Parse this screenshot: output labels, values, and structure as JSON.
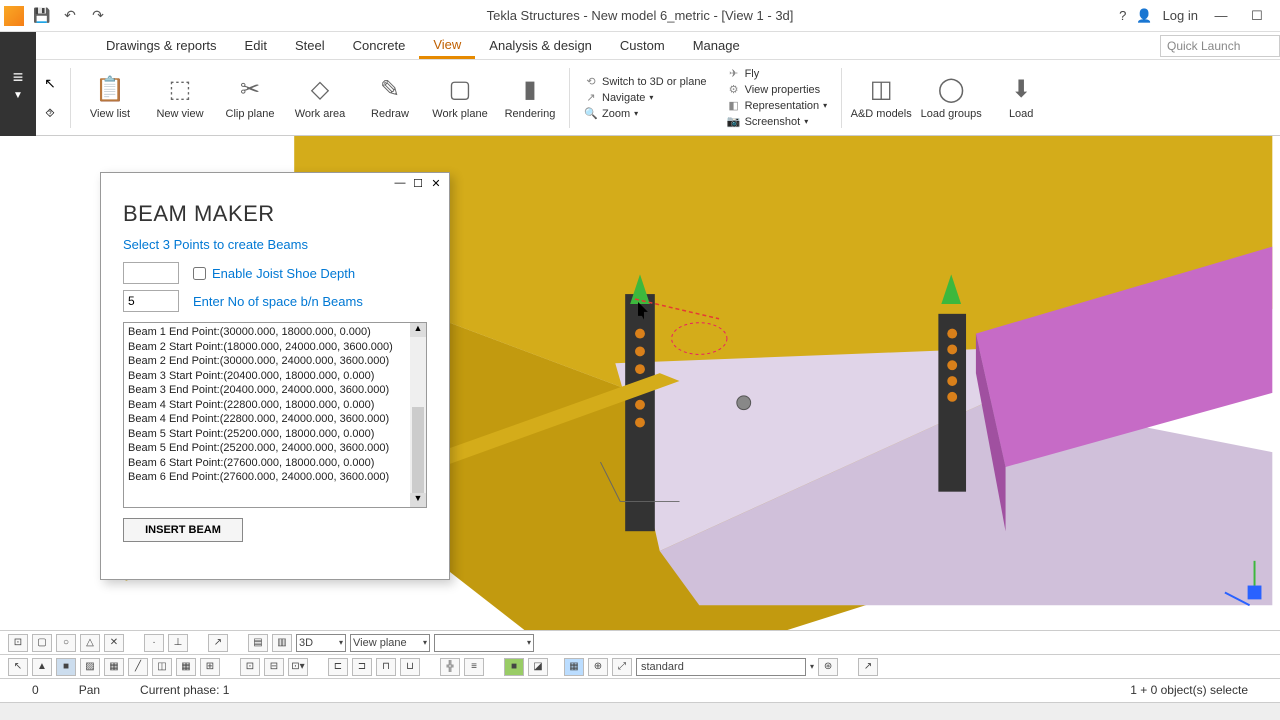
{
  "title": "Tekla Structures - New model 6_metric  - [View 1 - 3d]",
  "titlebar": {
    "login": "Log in",
    "help": "?"
  },
  "menu": {
    "items": [
      "Drawings & reports",
      "Edit",
      "Steel",
      "Concrete",
      "View",
      "Analysis & design",
      "Custom",
      "Manage"
    ],
    "active": 4,
    "search_placeholder": "Quick Launch"
  },
  "ribbon": {
    "view_list": "View list",
    "new_view": "New view",
    "clip_plane": "Clip plane",
    "work_area": "Work area",
    "redraw": "Redraw",
    "work_plane": "Work plane",
    "rendering": "Rendering",
    "switch": "Switch to 3D or plane",
    "navigate": "Navigate",
    "zoom": "Zoom",
    "fly": "Fly",
    "view_props": "View properties",
    "representation": "Representation",
    "screenshot": "Screenshot",
    "ad_models": "A&D models",
    "load_groups": "Load groups",
    "load": "Load"
  },
  "dialog": {
    "heading": "BEAM MAKER",
    "sub": "Select 3 Points to create Beams",
    "enable_joist": "Enable Joist Shoe Depth",
    "spaces_label": "Enter No of space b/n Beams",
    "spaces_value": "5",
    "items": [
      "Beam 1 End Point:(30000.000, 18000.000, 0.000)",
      "Beam 2 Start Point:(18000.000, 24000.000, 3600.000)",
      "Beam 2 End Point:(30000.000, 24000.000, 3600.000)",
      "Beam 3 Start Point:(20400.000, 18000.000, 0.000)",
      "Beam 3 End Point:(20400.000, 24000.000, 3600.000)",
      "Beam 4 Start Point:(22800.000, 18000.000, 0.000)",
      "Beam 4 End Point:(22800.000, 24000.000, 3600.000)",
      "Beam 5 Start Point:(25200.000, 18000.000, 0.000)",
      "Beam 5 End Point:(25200.000, 24000.000, 3600.000)",
      "Beam 6 Start Point:(27600.000, 18000.000, 0.000)",
      "Beam 6 End Point:(27600.000, 24000.000, 3600.000)"
    ],
    "insert": "INSERT BEAM"
  },
  "bottom": {
    "sel_3d": "3D",
    "sel_vp": "View plane",
    "standard": "standard"
  },
  "status": {
    "zero": "0",
    "pan": "Pan",
    "phase": "Current phase: 1",
    "sel": "1 + 0 object(s) selecte"
  }
}
